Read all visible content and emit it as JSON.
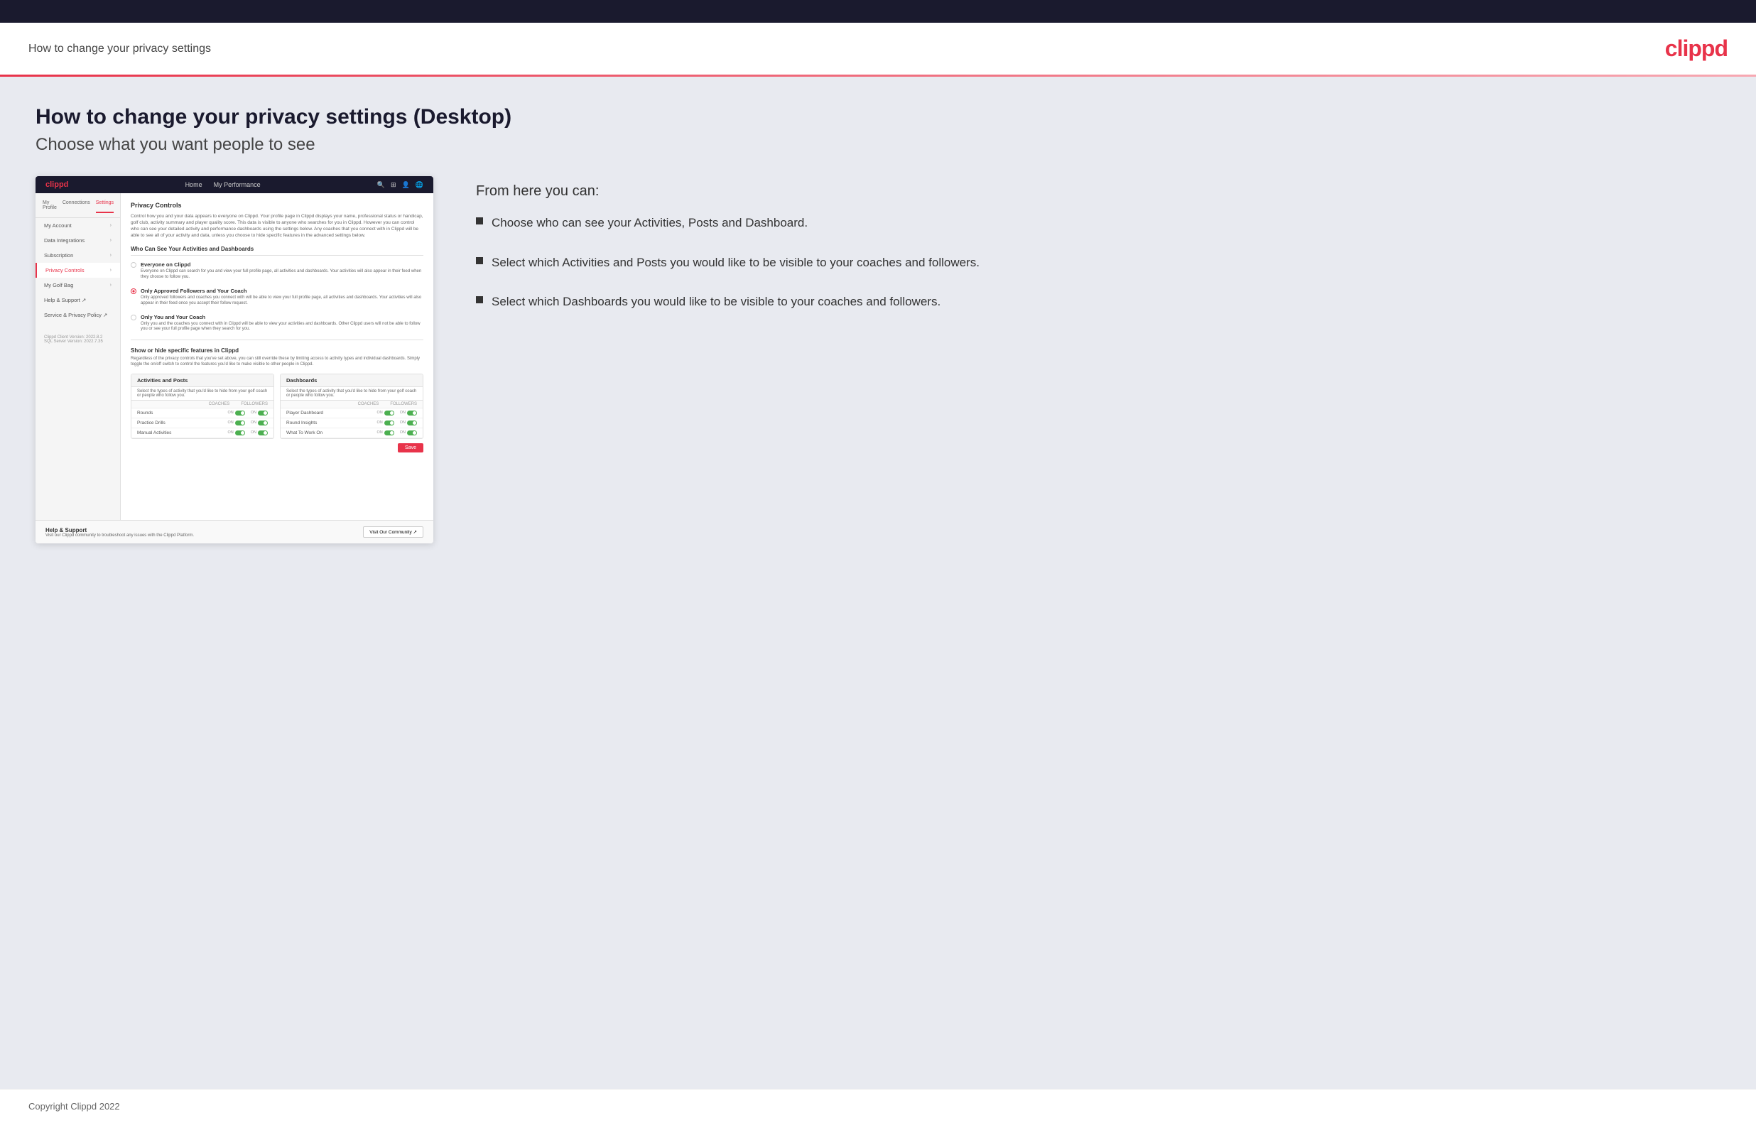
{
  "header": {
    "title": "How to change your privacy settings",
    "logo": "clippd"
  },
  "page": {
    "title": "How to change your privacy settings (Desktop)",
    "subtitle": "Choose what you want people to see"
  },
  "screenshot": {
    "nav": {
      "logo": "clippd",
      "links": [
        "Home",
        "My Performance"
      ],
      "icons": [
        "🔍",
        "⊞",
        "👤",
        "🌐"
      ]
    },
    "sidebar_tabs": [
      "My Profile",
      "Connections",
      "Settings"
    ],
    "sidebar_items": [
      {
        "label": "My Account",
        "active": false
      },
      {
        "label": "Data Integrations",
        "active": false
      },
      {
        "label": "Subscription",
        "active": false
      },
      {
        "label": "Privacy Controls",
        "active": true
      },
      {
        "label": "My Golf Bag",
        "active": false
      },
      {
        "label": "Help & Support ↗",
        "active": false
      },
      {
        "label": "Service & Privacy Policy ↗",
        "active": false
      }
    ],
    "sidebar_version": "Clippd Client Version: 2022.8.2\nSQL Server Version: 2022.7.35",
    "main": {
      "section_title": "Privacy Controls",
      "section_desc": "Control how you and your data appears to everyone on Clippd. Your profile page in Clippd displays your name, professional status or handicap, golf club, activity summary and player quality score. This data is visible to anyone who searches for you in Clippd. However you can control who can see your detailed activity and performance dashboards using the settings below. Any coaches that you connect with in Clippd will be able to see all of your activity and data, unless you choose to hide specific features in the advanced settings below.",
      "who_title": "Who Can See Your Activities and Dashboards",
      "options": [
        {
          "id": "everyone",
          "label": "Everyone on Clippd",
          "desc": "Everyone on Clippd can search for you and view your full profile page, all activities and dashboards. Your activities will also appear in their feed when they choose to follow you.",
          "selected": false
        },
        {
          "id": "followers",
          "label": "Only Approved Followers and Your Coach",
          "desc": "Only approved followers and coaches you connect with will be able to view your full profile page, all activities and dashboards. Your activities will also appear in their feed once you accept their follow request.",
          "selected": true
        },
        {
          "id": "coach_only",
          "label": "Only You and Your Coach",
          "desc": "Only you and the coaches you connect with in Clippd will be able to view your activities and dashboards. Other Clippd users will not be able to follow you or see your full profile page when they search for you.",
          "selected": false
        }
      ],
      "show_hide_title": "Show or hide specific features in Clippd",
      "show_hide_desc": "Regardless of the privacy controls that you've set above, you can still override these by limiting access to activity types and individual dashboards. Simply toggle the on/off switch to control the features you'd like to make visible to other people in Clippd.",
      "activities_posts": {
        "title": "Activities and Posts",
        "desc": "Select the types of activity that you'd like to hide from your golf coach or people who follow you.",
        "columns": [
          "COACHES",
          "FOLLOWERS"
        ],
        "rows": [
          {
            "label": "Rounds",
            "coaches_on": true,
            "followers_on": true
          },
          {
            "label": "Practice Drills",
            "coaches_on": true,
            "followers_on": true
          },
          {
            "label": "Manual Activities",
            "coaches_on": true,
            "followers_on": true
          }
        ]
      },
      "dashboards": {
        "title": "Dashboards",
        "desc": "Select the types of activity that you'd like to hide from your golf coach or people who follow you.",
        "columns": [
          "COACHES",
          "FOLLOWERS"
        ],
        "rows": [
          {
            "label": "Player Dashboard",
            "coaches_on": true,
            "followers_on": true
          },
          {
            "label": "Round Insights",
            "coaches_on": true,
            "followers_on": true
          },
          {
            "label": "What To Work On",
            "coaches_on": true,
            "followers_on": true
          }
        ]
      },
      "save_btn": "Save"
    },
    "help": {
      "title": "Help & Support",
      "desc": "Visit our Clippd community to troubleshoot any issues with the Clippd Platform.",
      "visit_btn": "Visit Our Community ↗"
    }
  },
  "info_panel": {
    "from_here": "From here you can:",
    "bullets": [
      "Choose who can see your Activities, Posts and Dashboard.",
      "Select which Activities and Posts you would like to be visible to your coaches and followers.",
      "Select which Dashboards you would like to be visible to your coaches and followers."
    ]
  },
  "footer": {
    "copyright": "Copyright Clippd 2022"
  }
}
